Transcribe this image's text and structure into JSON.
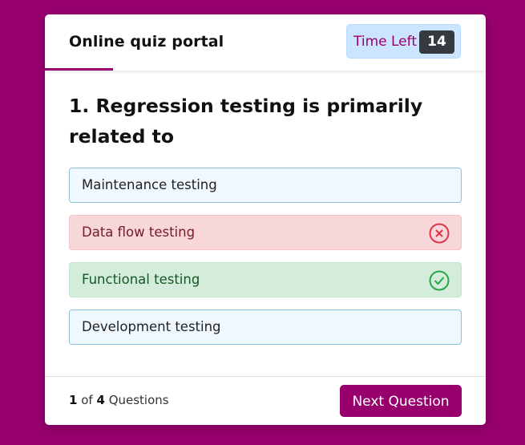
{
  "header": {
    "title": "Online quiz portal",
    "timer_label": "Time Left",
    "timer_value": "14"
  },
  "question": {
    "number": "1",
    "text": "1. Regression testing is primarily related to"
  },
  "options": [
    {
      "label": "Maintenance testing",
      "state": "neutral"
    },
    {
      "label": "Data flow testing",
      "state": "incorrect",
      "icon": "x-circle-icon"
    },
    {
      "label": "Functional testing",
      "state": "correct",
      "icon": "check-circle-icon"
    },
    {
      "label": "Development testing",
      "state": "neutral"
    }
  ],
  "footer": {
    "current": "1",
    "of_label": "of",
    "total": "4",
    "questions_label": "Questions",
    "next_button": "Next Question"
  },
  "colors": {
    "brand": "#98006e",
    "timer_bg": "#cce5ff",
    "incorrect": "#dc3545",
    "correct": "#28a745"
  }
}
